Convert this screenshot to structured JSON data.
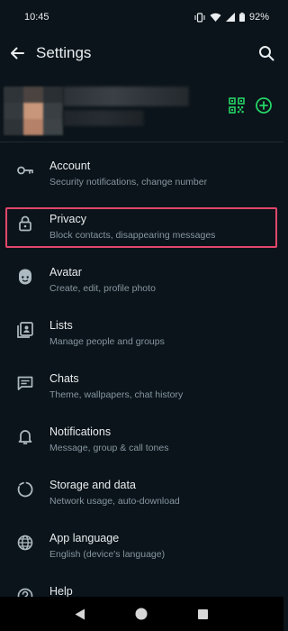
{
  "status_bar": {
    "time": "10:45",
    "battery": "92%",
    "icons": [
      "vibrate-icon",
      "wifi-icon",
      "signal-icon",
      "battery-icon"
    ]
  },
  "app_bar": {
    "title": "Settings",
    "back_icon": "arrow-left-icon",
    "search_icon": "search-icon"
  },
  "profile": {
    "qr_icon": "qr-code-icon",
    "add_icon": "add-circle-icon"
  },
  "colors": {
    "background": "#0b141a",
    "accent": "#25d366",
    "primary_text": "#e9edef",
    "secondary_text": "#8696a0",
    "highlight": "#e0476c"
  },
  "settings": [
    {
      "title": "Account",
      "subtitle": "Security notifications, change number",
      "icon": "key-icon"
    },
    {
      "title": "Privacy",
      "subtitle": "Block contacts, disappearing messages",
      "icon": "lock-icon",
      "highlighted": true
    },
    {
      "title": "Avatar",
      "subtitle": "Create, edit, profile photo",
      "icon": "avatar-face-icon"
    },
    {
      "title": "Lists",
      "subtitle": "Manage people and groups",
      "icon": "contact-list-icon"
    },
    {
      "title": "Chats",
      "subtitle": "Theme, wallpapers, chat history",
      "icon": "chat-icon"
    },
    {
      "title": "Notifications",
      "subtitle": "Message, group & call tones",
      "icon": "bell-icon"
    },
    {
      "title": "Storage and data",
      "subtitle": "Network usage, auto-download",
      "icon": "storage-circle-icon"
    },
    {
      "title": "App language",
      "subtitle": "English (device's language)",
      "icon": "globe-icon"
    },
    {
      "title": "Help",
      "subtitle": "",
      "icon": "help-icon"
    }
  ],
  "nav_bar": [
    "back-triangle-icon",
    "home-circle-icon",
    "recents-square-icon"
  ]
}
